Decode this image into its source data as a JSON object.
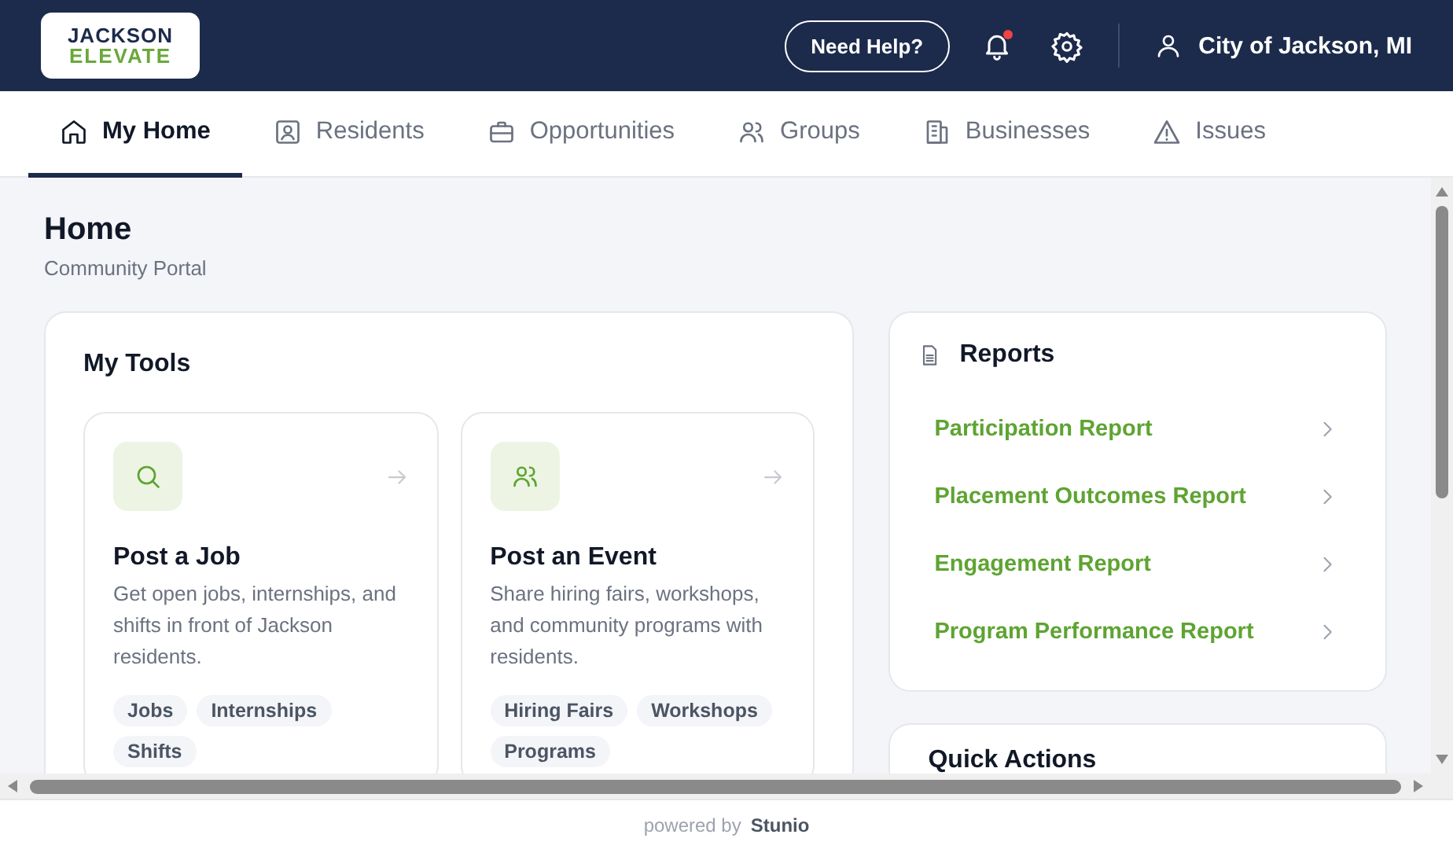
{
  "header": {
    "logo": {
      "line_1": "JACKSON",
      "line_2": "ELEVATE"
    },
    "help_button": "Need Help?",
    "notifications": {
      "unread": true
    },
    "user": "City of Jackson, MI"
  },
  "tabs": [
    {
      "label": "My Home",
      "selected": true
    },
    {
      "label": "Residents",
      "selected": false
    },
    {
      "label": "Opportunities",
      "selected": false
    },
    {
      "label": "Groups",
      "selected": false
    },
    {
      "label": "Businesses",
      "selected": false
    },
    {
      "label": "Issues",
      "selected": false
    }
  ],
  "page": {
    "title": "Home",
    "subtitle": "Community Portal"
  },
  "my_tools": {
    "title": "My Tools",
    "cards": [
      {
        "title": "Post a Job",
        "description": "Get open jobs, internships, and shifts in front of Jackson residents.",
        "tags": [
          "Jobs",
          "Internships",
          "Shifts"
        ]
      },
      {
        "title": "Post an Event",
        "description": "Share hiring fairs, workshops, and community programs with residents.",
        "tags": [
          "Hiring Fairs",
          "Workshops",
          "Programs"
        ]
      }
    ]
  },
  "reports": {
    "title": "Reports",
    "items": [
      "Participation Report",
      "Placement Outcomes Report",
      "Engagement Report",
      "Program Performance Report"
    ]
  },
  "quick_actions": {
    "title": "Quick Actions"
  },
  "footer": {
    "prefix": "powered by",
    "brand": "Stunio"
  }
}
